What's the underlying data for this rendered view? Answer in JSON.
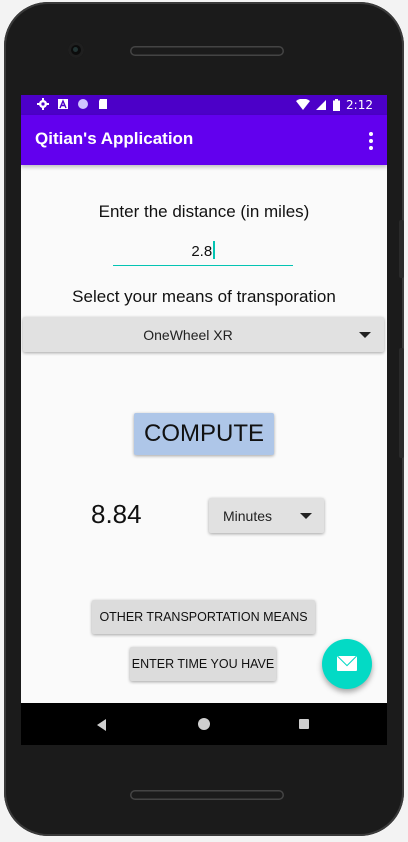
{
  "status_bar": {
    "time": "2:12",
    "left_icons": [
      "gear-icon",
      "a-icon",
      "circle-icon",
      "sd-card-icon"
    ],
    "right_icons": [
      "wifi-icon",
      "signal-icon",
      "battery-icon"
    ]
  },
  "app_bar": {
    "title": "Qitian's Application",
    "overflow_icon": "more-vert-icon"
  },
  "form": {
    "distance_label": "Enter the distance (in miles)",
    "distance_value": "2.8",
    "transport_label": "Select your means of transporation",
    "transport_selected": "OneWheel XR"
  },
  "compute_button": "COMPUTE",
  "result": {
    "value": "8.84",
    "unit_selected": "Minutes"
  },
  "buttons": {
    "other_transport": "OTHER TRANSPORTATION MEANS",
    "enter_time": "ENTER TIME YOU HAVE"
  },
  "fab_icon": "email-icon",
  "colors": {
    "status_bar": "#4c00c8",
    "app_bar": "#6200ee",
    "accent": "#03dac5",
    "compute_button": "#aec6e8"
  },
  "nav_bar": [
    "back-icon",
    "home-icon",
    "recents-icon"
  ]
}
